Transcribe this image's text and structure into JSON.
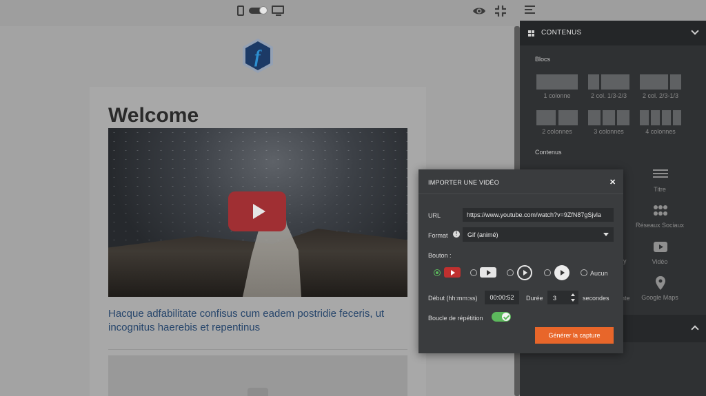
{
  "editor": {
    "heading": "Welcome",
    "body_text": "Hacque adfabilitate confisus cum eadem postridie feceris, ut incognitus haerebis et repentinus",
    "logo_letter": "f"
  },
  "sidebar": {
    "section_title": "CONTENUS",
    "blocs_label": "Blocs",
    "layouts": [
      {
        "label": "1 colonne"
      },
      {
        "label": "2 col. 1/3-2/3"
      },
      {
        "label": "2 col. 2/3-1/3"
      },
      {
        "label": "2 colonnes"
      },
      {
        "label": "3 colonnes"
      },
      {
        "label": "4 colonnes"
      }
    ],
    "contenus_label": "Contenus",
    "content_items": [
      {
        "label": "Titre",
        "icon": "title-icon"
      },
      {
        "label": "Réseaux Sociaux",
        "icon": "social-icon"
      },
      {
        "label": "Vidéo",
        "icon": "video-icon"
      },
      {
        "label": "Google Maps",
        "icon": "map-pin-icon"
      }
    ],
    "partial_labels": [
      "nte",
      "y"
    ]
  },
  "modal": {
    "title": "IMPORTER UNE VIDÉO",
    "url_label": "URL",
    "url_value": "https://www.youtube.com/watch?v=9ZfN87gSjvla",
    "format_label": "Format",
    "format_value": "Gif (animé)",
    "bouton_label": "Bouton :",
    "button_styles": [
      "red-play",
      "white-play",
      "outline-circle-play",
      "filled-circle-play",
      "none"
    ],
    "button_none_label": "Aucun",
    "selected_style": "red-play",
    "debut_label": "Début (hh:mm:ss)",
    "debut_value": "00:00:52",
    "duree_label": "Durée",
    "duree_value": "3",
    "secondes_label": "secondes",
    "loop_label": "Boucle de répétition",
    "loop_on": true,
    "generate_label": "Générer la capture"
  },
  "colors": {
    "accent": "#e8662a",
    "toggle_on": "#5cb85c",
    "play_red": "#c0302f",
    "link_blue": "#26456b"
  }
}
